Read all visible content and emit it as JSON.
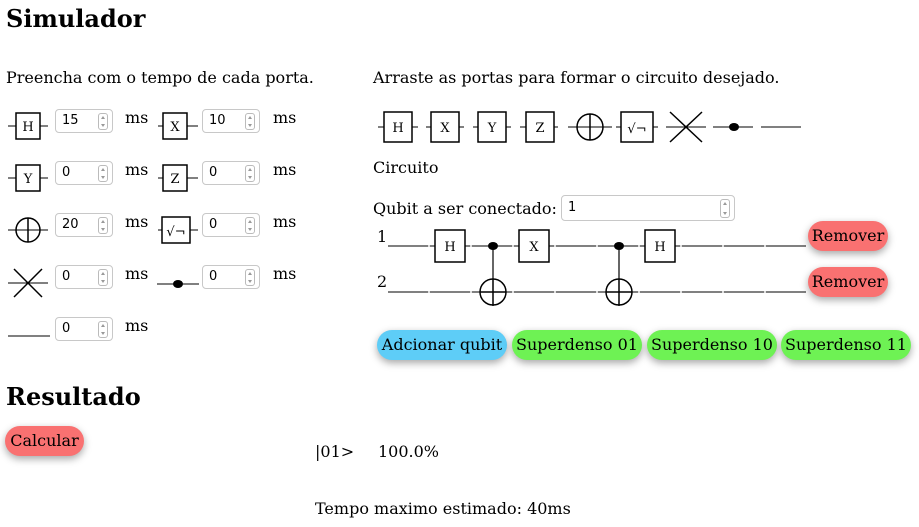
{
  "title": "Simulador",
  "timing": {
    "instruction": "Preencha com o tempo de cada porta.",
    "unit": "ms",
    "gates": [
      {
        "icon": "h-gate-icon",
        "label": "H",
        "value": "15"
      },
      {
        "icon": "x-gate-icon",
        "label": "X",
        "value": "10"
      },
      {
        "icon": "y-gate-icon",
        "label": "Y",
        "value": "0"
      },
      {
        "icon": "z-gate-icon",
        "label": "Z",
        "value": "0"
      },
      {
        "icon": "cnot-target-icon",
        "label": "",
        "value": "20"
      },
      {
        "icon": "sqrt-gate-icon",
        "label": "√¬",
        "value": "0"
      },
      {
        "icon": "swap-icon",
        "label": "",
        "value": "0"
      },
      {
        "icon": "control-dot-icon",
        "label": "",
        "value": "0"
      },
      {
        "icon": "wire-icon",
        "label": "",
        "value": "0"
      }
    ]
  },
  "palette": {
    "instruction": "Arraste as portas para formar o circuito desejado.",
    "gates": [
      "H",
      "X",
      "Y",
      "Z"
    ]
  },
  "circuit": {
    "label": "Circuito",
    "qubit_label": "Qubit a ser conectado:",
    "qubit_value": "1",
    "qubits": [
      {
        "number": "1",
        "gates": [
          "H",
          "●",
          "X",
          "●",
          "H"
        ],
        "remove": "Remover"
      },
      {
        "number": "2",
        "gates": [
          "⊕",
          "⊕"
        ],
        "remove": "Remover"
      }
    ],
    "buttons": {
      "add_qubit": "Adcionar qubit",
      "sd01": "Superdenso 01",
      "sd10": "Superdenso 10",
      "sd11": "Superdenso 11"
    }
  },
  "result": {
    "title": "Resultado",
    "calc": "Calcular",
    "state": "|01>",
    "probability": "100.0%",
    "time_text": "Tempo maximo estimado: 40ms"
  },
  "colors": {
    "remove": "#f97171",
    "add": "#5ecdf7",
    "preset": "#6ef254"
  }
}
